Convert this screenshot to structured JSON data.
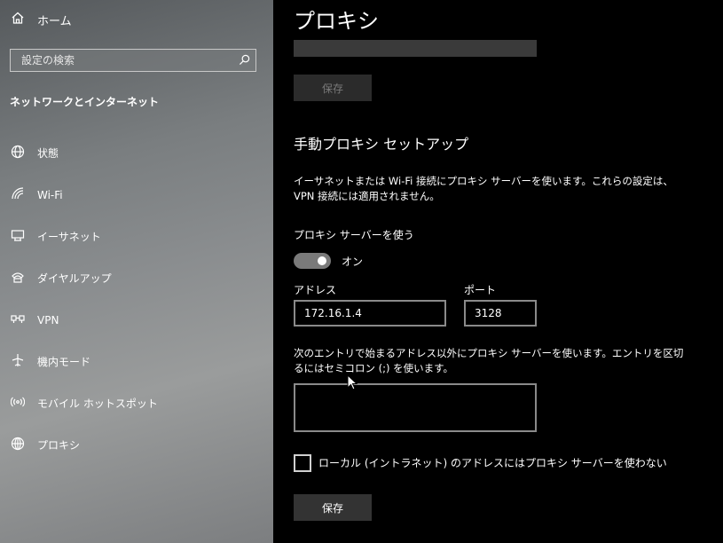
{
  "sidebar": {
    "home_label": "ホーム",
    "search_placeholder": "設定の検索",
    "section_title": "ネットワークとインターネット",
    "items": [
      {
        "label": "状態",
        "icon": "globe-status-icon"
      },
      {
        "label": "Wi-Fi",
        "icon": "wifi-icon"
      },
      {
        "label": "イーサネット",
        "icon": "ethernet-icon"
      },
      {
        "label": "ダイヤルアップ",
        "icon": "dialup-icon"
      },
      {
        "label": "VPN",
        "icon": "vpn-icon"
      },
      {
        "label": "機内モード",
        "icon": "airplane-icon"
      },
      {
        "label": "モバイル ホットスポット",
        "icon": "hotspot-icon"
      },
      {
        "label": "プロキシ",
        "icon": "globe-icon"
      }
    ]
  },
  "main": {
    "title": "プロキシ",
    "save_button_top": "保存",
    "manual_heading": "手動プロキシ セットアップ",
    "description": "イーサネットまたは Wi-Fi 接続にプロキシ サーバーを使います。これらの設定は、VPN 接続には適用されません。",
    "use_proxy_label": "プロキシ サーバーを使う",
    "toggle_state": "オン",
    "address_label": "アドレス",
    "address_value": "172.16.1.4",
    "port_label": "ポート",
    "port_value": "3128",
    "exceptions_description": "次のエントリで始まるアドレス以外にプロキシ サーバーを使います。エントリを区切るにはセミコロン (;) を使います。",
    "exceptions_value": "",
    "bypass_local_label": "ローカル (イントラネット) のアドレスにはプロキシ サーバーを使わない",
    "save_button_bottom": "保存"
  }
}
